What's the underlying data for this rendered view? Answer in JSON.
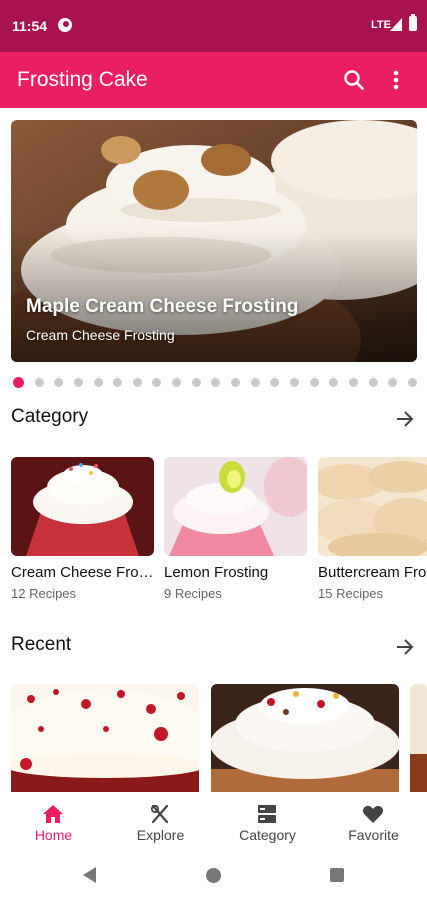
{
  "status_bar": {
    "time": "11:54",
    "network": "LTE"
  },
  "app_bar": {
    "title": "Frosting Cake",
    "search_icon": "search-icon",
    "more_icon": "more-vert-icon"
  },
  "hero": {
    "title": "Maple Cream Cheese Frosting",
    "subtitle": "Cream Cheese Frosting",
    "page_count": 21,
    "active_page": 1
  },
  "category": {
    "title": "Category",
    "items": [
      {
        "name": "Cream Cheese Frosting",
        "count": "12 Recipes"
      },
      {
        "name": "Lemon Frosting",
        "count": "9 Recipes"
      },
      {
        "name": "Buttercream Frosting",
        "count": "15 Recipes"
      }
    ]
  },
  "recent": {
    "title": "Recent"
  },
  "bottom_nav": {
    "items": [
      {
        "label": "Home",
        "icon": "home-icon",
        "active": true
      },
      {
        "label": "Explore",
        "icon": "fork-knife-icon",
        "active": false
      },
      {
        "label": "Category",
        "icon": "category-list-icon",
        "active": false
      },
      {
        "label": "Favorite",
        "icon": "heart-icon",
        "active": false
      }
    ]
  },
  "colors": {
    "primary": "#e91e63",
    "status_bar": "#a8124e",
    "inactive_dot": "#c9c9c9"
  }
}
